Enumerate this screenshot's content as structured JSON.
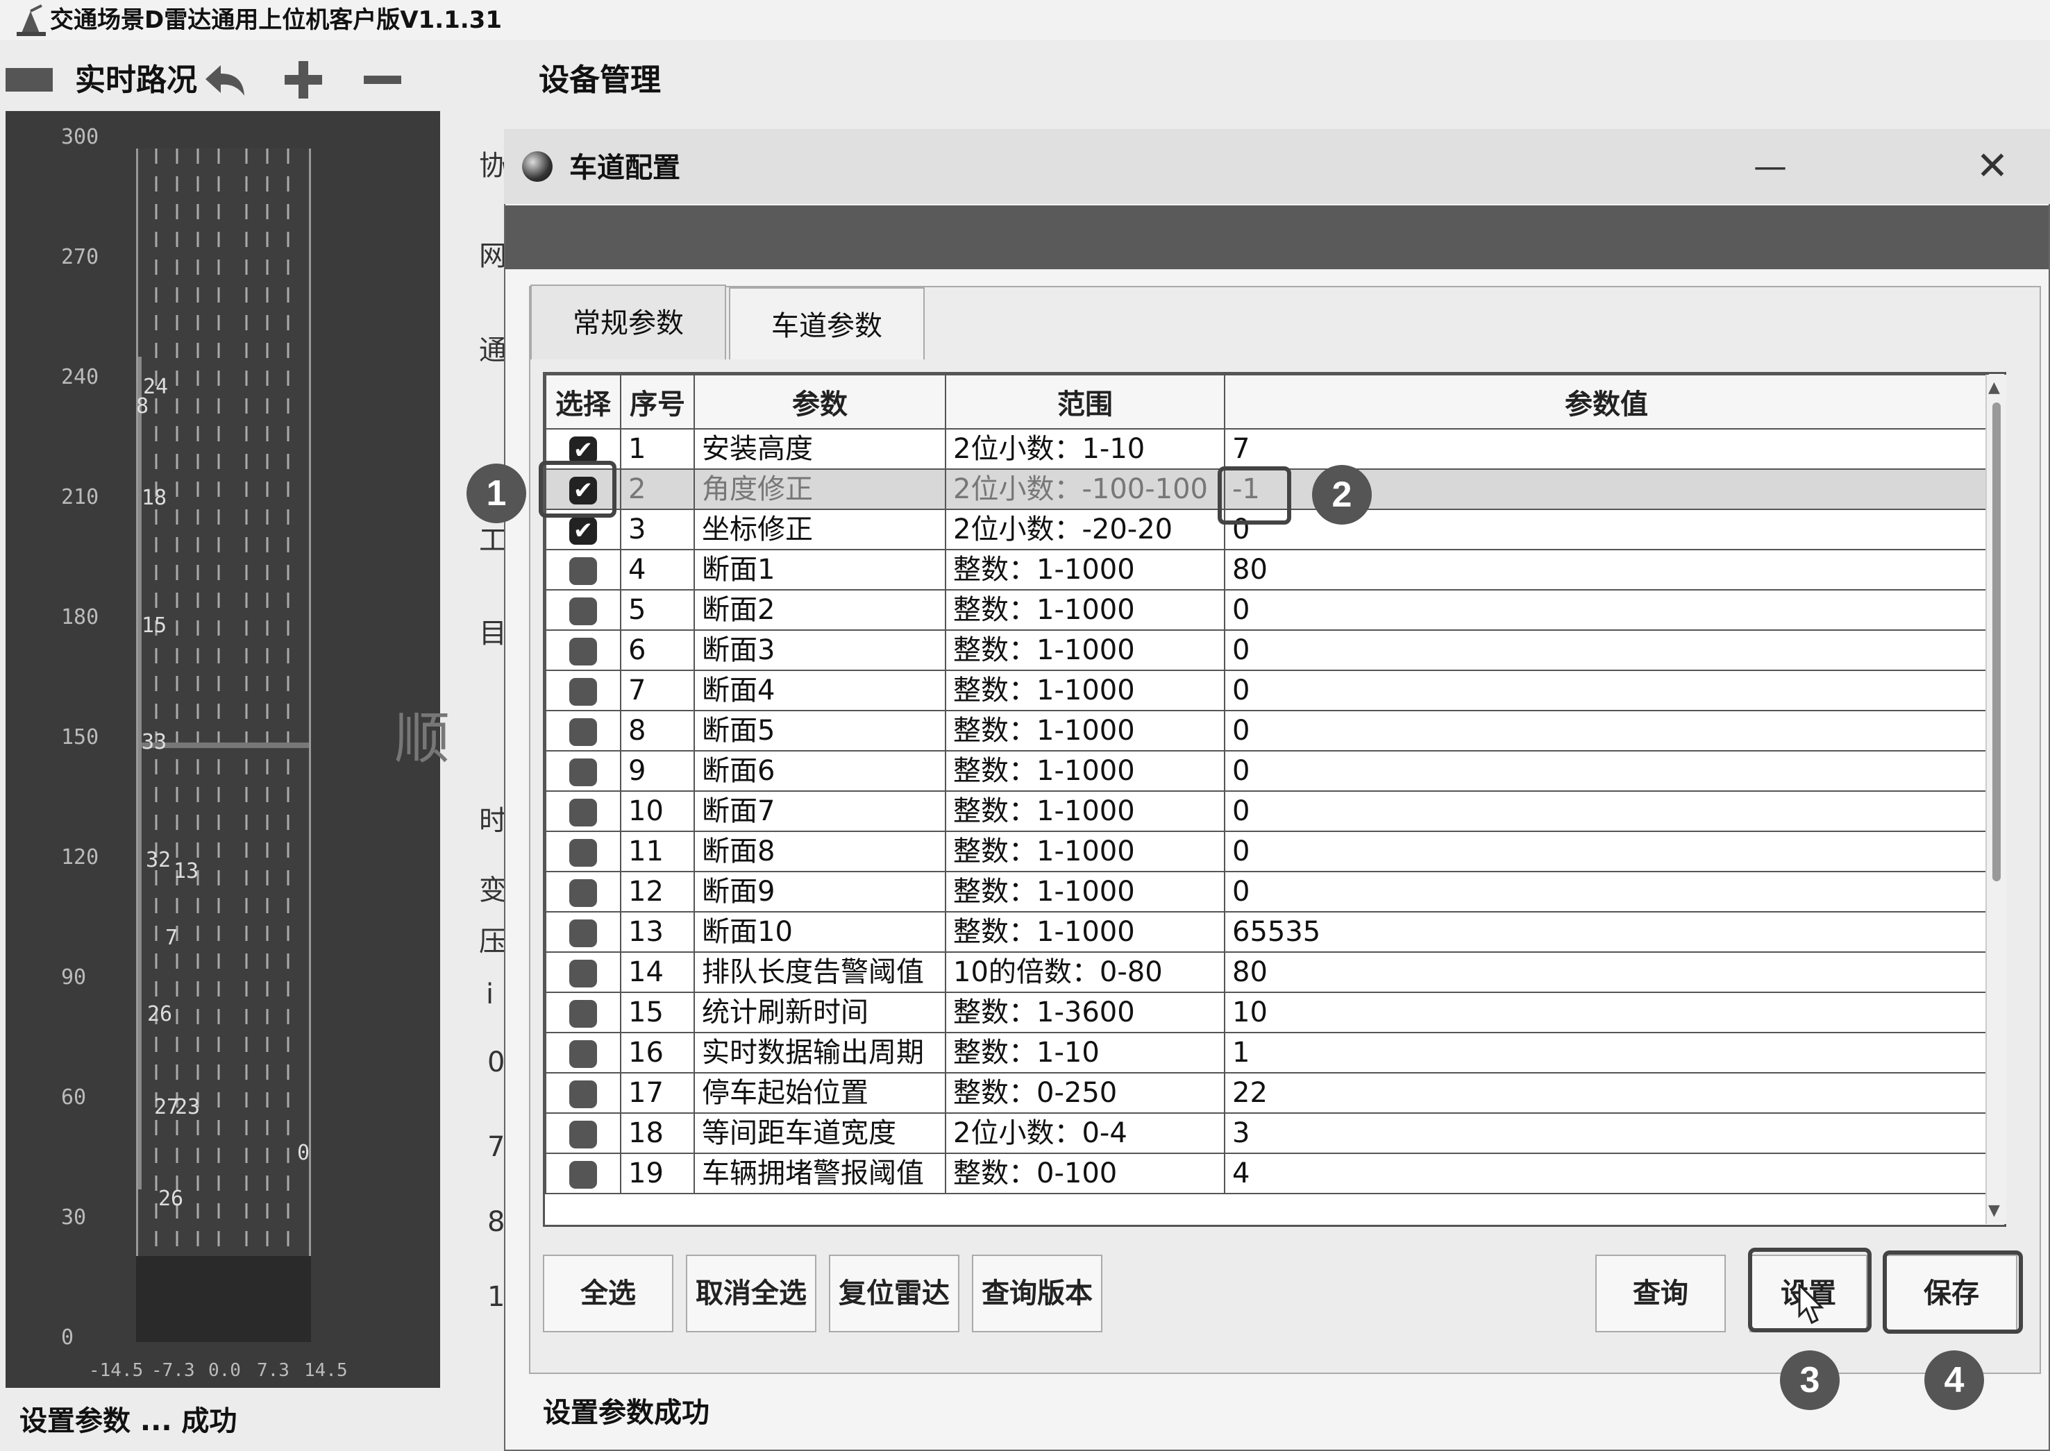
{
  "app": {
    "title": "交通场景D雷达通用上位机客户版V1.1.31"
  },
  "toolbar": {
    "realtime_label": "实时路况",
    "device_management": "设备管理"
  },
  "radar": {
    "y_ticks": [
      "300",
      "270",
      "240",
      "210",
      "180",
      "150",
      "120",
      "90",
      "60",
      "30",
      "0"
    ],
    "x_ticks": [
      "-14.5",
      "-7.3",
      "0.0",
      "7.3",
      "14.5"
    ],
    "vehicle_labels": [
      "24",
      "8",
      "18",
      "15",
      "33",
      "32",
      "13",
      "7",
      "26",
      "27",
      "23",
      "0",
      "26"
    ]
  },
  "behind": {
    "labels": [
      "协",
      "网",
      "通",
      "工",
      "目",
      "时",
      "变",
      "压",
      "i",
      "0",
      "7",
      "8",
      "1"
    ],
    "watermark": "顺"
  },
  "status_main": "设置参数 ... 成功",
  "dialog": {
    "title": "车道配置",
    "min_glyph": "—",
    "close_glyph": "✕",
    "tabs": [
      "常规参数",
      "车道参数"
    ],
    "columns": [
      "选择",
      "序号",
      "参数",
      "范围",
      "参数值"
    ],
    "rows": [
      {
        "checked": true,
        "no": "1",
        "param": "安装高度",
        "range": "2位小数：1-10",
        "value": "7"
      },
      {
        "checked": true,
        "no": "2",
        "param": "角度修正",
        "range": "2位小数：-100-100",
        "value": "-1"
      },
      {
        "checked": true,
        "no": "3",
        "param": "坐标修正",
        "range": "2位小数：-20-20",
        "value": "0"
      },
      {
        "checked": false,
        "no": "4",
        "param": "断面1",
        "range": "整数：1-1000",
        "value": "80"
      },
      {
        "checked": false,
        "no": "5",
        "param": "断面2",
        "range": "整数：1-1000",
        "value": "0"
      },
      {
        "checked": false,
        "no": "6",
        "param": "断面3",
        "range": "整数：1-1000",
        "value": "0"
      },
      {
        "checked": false,
        "no": "7",
        "param": "断面4",
        "range": "整数：1-1000",
        "value": "0"
      },
      {
        "checked": false,
        "no": "8",
        "param": "断面5",
        "range": "整数：1-1000",
        "value": "0"
      },
      {
        "checked": false,
        "no": "9",
        "param": "断面6",
        "range": "整数：1-1000",
        "value": "0"
      },
      {
        "checked": false,
        "no": "10",
        "param": "断面7",
        "range": "整数：1-1000",
        "value": "0"
      },
      {
        "checked": false,
        "no": "11",
        "param": "断面8",
        "range": "整数：1-1000",
        "value": "0"
      },
      {
        "checked": false,
        "no": "12",
        "param": "断面9",
        "range": "整数：1-1000",
        "value": "0"
      },
      {
        "checked": false,
        "no": "13",
        "param": "断面10",
        "range": "整数：1-1000",
        "value": "65535"
      },
      {
        "checked": false,
        "no": "14",
        "param": "排队长度告警阈值",
        "range": "10的倍数：0-80",
        "value": "80"
      },
      {
        "checked": false,
        "no": "15",
        "param": "统计刷新时间",
        "range": "整数：1-3600",
        "value": "10"
      },
      {
        "checked": false,
        "no": "16",
        "param": "实时数据输出周期",
        "range": "整数：1-10",
        "value": "1"
      },
      {
        "checked": false,
        "no": "17",
        "param": "停车起始位置",
        "range": "整数：0-250",
        "value": "22"
      },
      {
        "checked": false,
        "no": "18",
        "param": "等间距车道宽度",
        "range": "2位小数：0-4",
        "value": "3"
      },
      {
        "checked": false,
        "no": "19",
        "param": "车辆拥堵警报阈值",
        "range": "整数：0-100",
        "value": "4"
      }
    ],
    "buttons": {
      "select_all": "全选",
      "unselect_all": "取消全选",
      "reset_radar": "复位雷达",
      "query_version": "查询版本",
      "query": "查询",
      "set": "设置",
      "save": "保存"
    },
    "status": "设置参数成功",
    "badges": [
      "1",
      "2",
      "3",
      "4"
    ]
  }
}
